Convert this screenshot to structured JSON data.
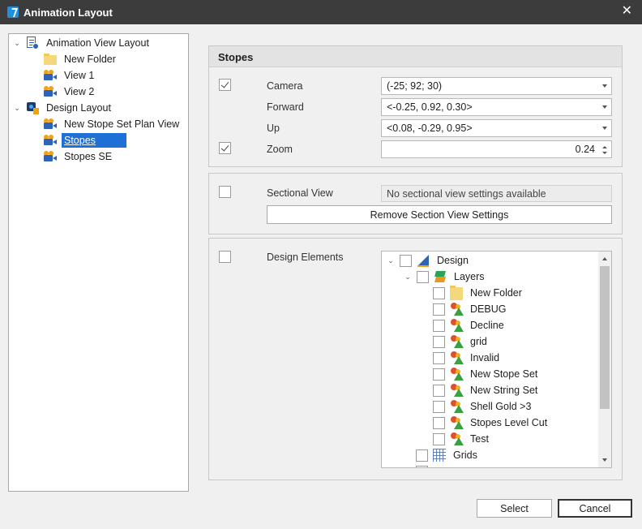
{
  "window": {
    "title": "Animation Layout",
    "close_glyph": "✕"
  },
  "tree": [
    {
      "label": "Animation View Layout",
      "icon": "layout-icon",
      "expanded": true
    },
    {
      "label": "New Folder",
      "icon": "folder-icon"
    },
    {
      "label": "View 1",
      "icon": "camera-icon"
    },
    {
      "label": "View 2",
      "icon": "camera-icon"
    },
    {
      "label": "Design Layout",
      "icon": "design-icon",
      "expanded": true
    },
    {
      "label": "New Stope Set Plan View",
      "icon": "camera-icon"
    },
    {
      "label": "Stopes",
      "icon": "camera-icon",
      "selected": true
    },
    {
      "label": "Stopes SE",
      "icon": "camera-icon"
    }
  ],
  "stopes": {
    "header": "Stopes",
    "camera": {
      "label": "Camera",
      "checked": true,
      "value": "(-25; 92; 30)"
    },
    "forward": {
      "label": "Forward",
      "value": "<-0.25, 0.92, 0.30>"
    },
    "up": {
      "label": "Up",
      "value": "<0.08, -0.29, 0.95>"
    },
    "zoom": {
      "label": "Zoom",
      "checked": true,
      "value": "0.24"
    }
  },
  "sectional": {
    "label": "Sectional View",
    "checked": false,
    "info": "No sectional view settings available",
    "remove_button": "Remove Section View Settings"
  },
  "design_elements": {
    "label": "Design Elements",
    "checked": false,
    "tree": [
      {
        "label": "Design",
        "icon": "design-set-icon",
        "expander": "⌄",
        "level": 0
      },
      {
        "label": "Layers",
        "icon": "layers-icon",
        "expander": "⌄",
        "level": 1
      },
      {
        "label": "New Folder",
        "icon": "folder-icon",
        "level": 2
      },
      {
        "label": "DEBUG",
        "icon": "layer-item-icon",
        "level": 2
      },
      {
        "label": "Decline",
        "icon": "layer-item-icon",
        "level": 2
      },
      {
        "label": "grid",
        "icon": "layer-item-icon",
        "level": 2
      },
      {
        "label": "Invalid",
        "icon": "layer-item-icon",
        "level": 2
      },
      {
        "label": "New Stope Set",
        "icon": "layer-item-icon",
        "level": 2
      },
      {
        "label": "New String Set",
        "icon": "layer-item-icon",
        "level": 2
      },
      {
        "label": "Shell Gold >3",
        "icon": "layer-item-icon",
        "level": 2
      },
      {
        "label": "Stopes Level Cut",
        "icon": "layer-item-icon",
        "level": 2
      },
      {
        "label": "Test",
        "icon": "layer-item-icon",
        "level": 2
      },
      {
        "label": "Grids",
        "icon": "grids-icon",
        "level": 1
      }
    ]
  },
  "footer": {
    "select_label": "Select",
    "cancel_label": "Cancel"
  },
  "colors": {
    "titlebar": "#3c3c3c",
    "selection": "#1e6fd6",
    "accent": "#2f63b5"
  }
}
